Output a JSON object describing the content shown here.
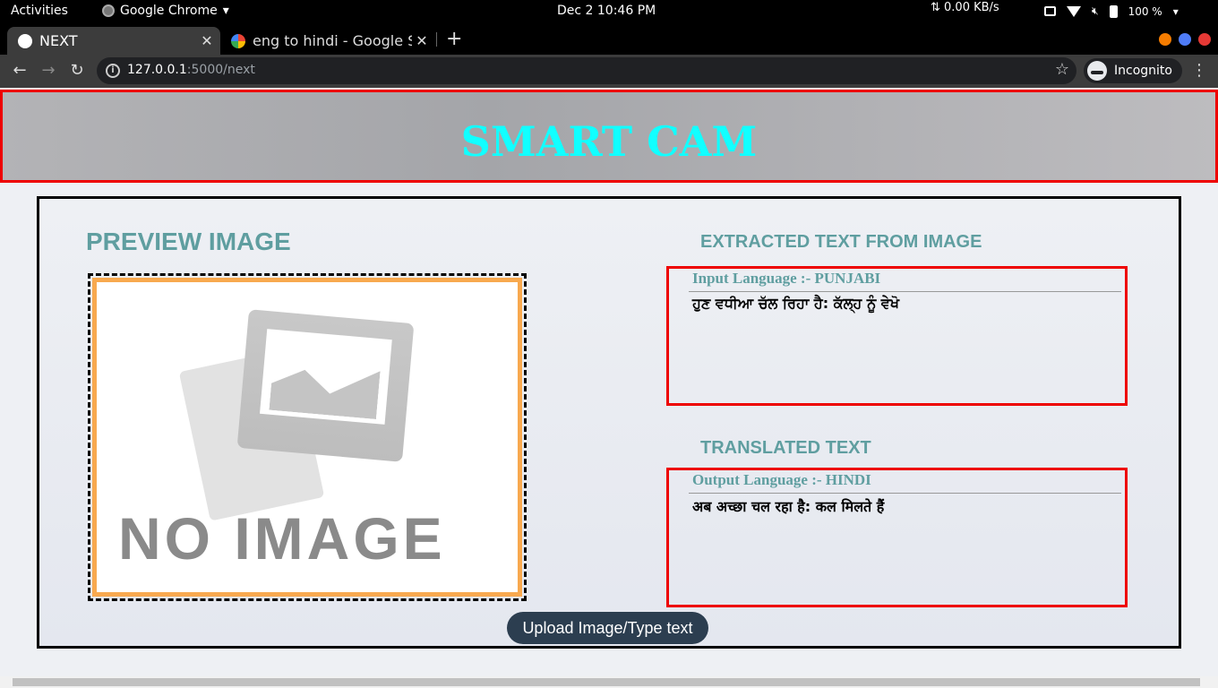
{
  "topbar": {
    "activities": "Activities",
    "app_name": "Google Chrome",
    "clock": "Dec 2  10:46 PM",
    "network": "⇅ 0.00 KB/s",
    "battery": "100 %"
  },
  "tabs": [
    {
      "title": "NEXT",
      "active": true
    },
    {
      "title": "eng to hindi - Google S",
      "active": false
    }
  ],
  "window_controls": {
    "colors": [
      "#f57c00",
      "#4f7cf7",
      "#e53935"
    ]
  },
  "address_bar": {
    "url_host": "127.0.0.1",
    "url_rest": ":5000/next",
    "profile_label": "Incognito"
  },
  "header": {
    "title": "SMART CAM",
    "title_color": "#1ff"
  },
  "preview": {
    "title": "PREVIEW IMAGE",
    "placeholder_text": "NO IMAGE",
    "frame_color": "#f8a94f"
  },
  "extracted": {
    "title": "EXTRACTED TEXT FROM IMAGE",
    "language_label": "Input Language :- PUNJABI",
    "text": "ਹੁਣ ਵਧੀਆ ਚੱਲ ਰਿਹਾ ਹੈ: ਕੱਲ੍ਹ ਨੂੰ ਵੇਖੋ"
  },
  "translated": {
    "title": "TRANSLATED TEXT",
    "language_label": "Output Language :- HINDI",
    "text": "अब अच्छा चल रहा है: कल मिलते हैं"
  },
  "actions": {
    "upload_label": "Upload Image/Type text"
  },
  "colors": {
    "accent": "#5f9ea0",
    "border_red": "#e00",
    "button_dark": "#2c3e50"
  }
}
